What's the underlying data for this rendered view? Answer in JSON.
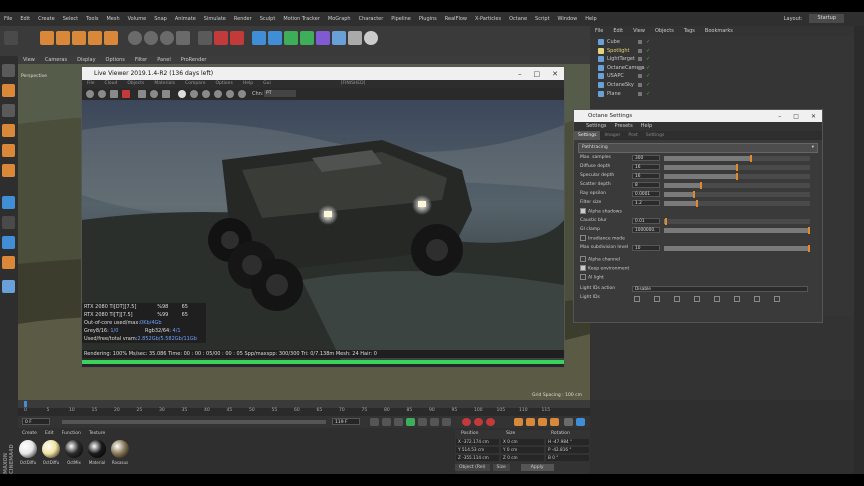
{
  "menubar": {
    "items": [
      "File",
      "Edit",
      "Create",
      "Select",
      "Tools",
      "Mesh",
      "Volume",
      "Snap",
      "Animate",
      "Simulate",
      "Render",
      "Sculpt",
      "Motion Tracker",
      "MoGraph",
      "Character",
      "Pipeline",
      "Plugins",
      "RealFlow",
      "X-Particles",
      "Octane",
      "Script",
      "Window",
      "Help"
    ],
    "layout_label": "Layout:",
    "layout_value": "Startup"
  },
  "viewport": {
    "menu": [
      "View",
      "Cameras",
      "Display",
      "Options",
      "Filter",
      "Panel",
      "ProRender"
    ],
    "camera_label": "Perspective",
    "grid_spacing": "Grid Spacing : 100 cm"
  },
  "live_viewer": {
    "title": "Live Viewer 2019.1.4-R2 (136 days left)",
    "menu": [
      "File",
      "Cloud",
      "Objects",
      "Materials",
      "Compare",
      "Options",
      "Help",
      "Gui"
    ],
    "status": "[FINISHED]",
    "channel_label": "Chn:",
    "channel_value": "PT",
    "stats": {
      "gpu1": {
        "name": "RTX 2080 Ti[DT][7.5]",
        "usage": "%98",
        "temp": "65"
      },
      "gpu2": {
        "name": "RTX 2080 Ti[T][7.5]",
        "usage": "%99",
        "temp": "65"
      },
      "out_of_core_label": "Out-of-core used/max:",
      "out_of_core_value": "0Kb/4Gb",
      "grey_label": "Grey8/16:",
      "grey_value": "1/0",
      "rgb_label": "Rgb32/64:",
      "rgb_value": "4/1",
      "vram_label": "Used/free/total vram:",
      "vram_value": "2.852Gb/5.582Gb/11Gb"
    },
    "status_line": "Rendering: 100%  Ms/sec: 35.086    Time: 00 : 00 : 05/00 : 00 : 05   Spp/maxspp: 300/300    Tri: 0/7.138m    Mesh: 24    Hair: 0",
    "progress": 1.0
  },
  "object_manager": {
    "menu": [
      "File",
      "Edit",
      "View",
      "Objects",
      "Tags",
      "Bookmarks"
    ],
    "items": [
      {
        "name": "Cube",
        "color": "#c8c8c8"
      },
      {
        "name": "Spotlight",
        "color": "#e6d27a"
      },
      {
        "name": "LightTarget",
        "color": "#c8c8c8"
      },
      {
        "name": "OctaneCamera",
        "color": "#c8c8c8"
      },
      {
        "name": "USAPC",
        "color": "#c8c8c8"
      },
      {
        "name": "OctaneSky",
        "color": "#c8c8c8"
      },
      {
        "name": "Plane",
        "color": "#c8c8c8"
      }
    ]
  },
  "octane_settings": {
    "title": "Octane Settings",
    "menu": [
      "Settings",
      "Presets",
      "Help"
    ],
    "tabs": [
      "Settings",
      "Imager",
      "Post",
      "Settings"
    ],
    "kernel": "Pathtracing",
    "params": [
      {
        "label": "Max. samples",
        "value": "300",
        "fill": 0.6
      },
      {
        "label": "Diffuse depth",
        "value": "16",
        "fill": 0.5
      },
      {
        "label": "Specular depth",
        "value": "16",
        "fill": 0.5
      },
      {
        "label": "Scatter depth",
        "value": "8",
        "fill": 0.25
      },
      {
        "label": "Ray epsilon",
        "value": "0.0001",
        "fill": 0.2
      },
      {
        "label": "Filter size",
        "value": "1.2",
        "fill": 0.22
      }
    ],
    "alpha_shadows": "Alpha shadows",
    "params2": [
      {
        "label": "Caustic blur",
        "value": "0.01",
        "fill": 0.01
      },
      {
        "label": "GI clamp",
        "value": "1000000.",
        "fill": 1.0
      }
    ],
    "irradiance": "Irradiance mode",
    "max_subdiv_label": "Max subdivision level",
    "max_subdiv_value": "10",
    "alpha_channel": "Alpha channel",
    "keep_environment": "Keep environment",
    "ai_light": "AI light",
    "light_ids_action_label": "Light IDs action",
    "light_ids_action_value": "Disable",
    "light_ids_label": "Light IDs"
  },
  "timeline": {
    "ticks": [
      "0",
      "5",
      "10",
      "15",
      "20",
      "25",
      "30",
      "35",
      "40",
      "45",
      "50",
      "55",
      "60",
      "65",
      "70",
      "75",
      "80",
      "85",
      "90",
      "95",
      "100",
      "105",
      "110",
      "115"
    ],
    "start_frame": "0 F",
    "end_frame": "119 F",
    "frame_field": "0 F"
  },
  "materials": {
    "menu": [
      "Create",
      "Edit",
      "Function",
      "Texture"
    ],
    "items": [
      {
        "name": "OctDiffu",
        "color": "#e8e8e8"
      },
      {
        "name": "OctDiffu",
        "color": "#f0e3a0"
      },
      {
        "name": "OctMix",
        "color": "#2a2a2a"
      },
      {
        "name": "Material",
        "color": "#1a1a1a"
      },
      {
        "name": "Rosasus",
        "color": "#8a7a5a"
      }
    ]
  },
  "coordinates": {
    "headers": [
      "Position",
      "Size",
      "Rotation"
    ],
    "rows": [
      [
        "X",
        "-372.174 cm",
        "0 cm",
        "H",
        "-47.984 °"
      ],
      [
        "Y",
        "514.53 cm",
        "0 cm",
        "P",
        "-42.816 °"
      ],
      [
        "Z",
        "-355.114 cm",
        "0 cm",
        "B",
        "0 °"
      ]
    ],
    "mode": "Object (Rel)",
    "size_mode": "Size",
    "apply": "Apply"
  },
  "brand": "MAXON CINEMA4D"
}
